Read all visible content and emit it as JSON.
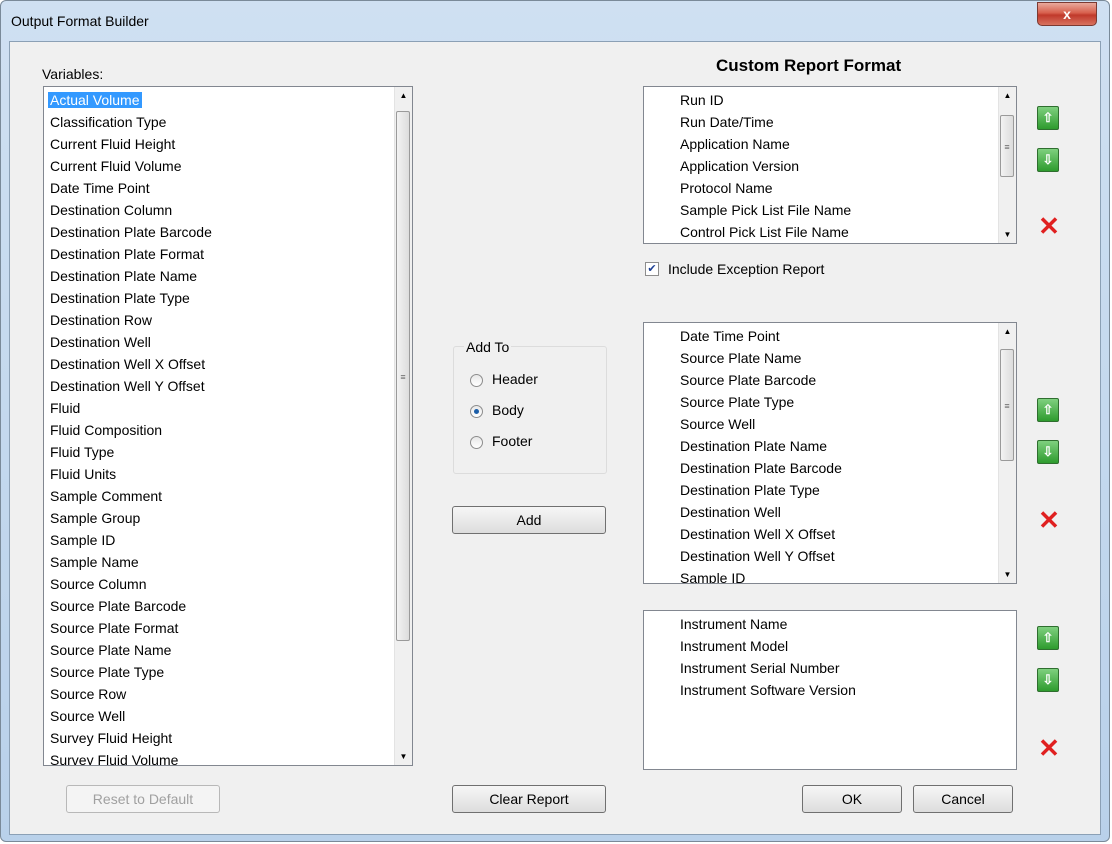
{
  "window": {
    "title": "Output Format Builder",
    "close_glyph": "x"
  },
  "variables": {
    "label": "Variables:",
    "items": [
      {
        "label": "Actual Volume",
        "selected": true
      },
      {
        "label": "Classification Type"
      },
      {
        "label": "Current Fluid Height"
      },
      {
        "label": "Current Fluid Volume"
      },
      {
        "label": "Date Time Point"
      },
      {
        "label": "Destination Column"
      },
      {
        "label": "Destination Plate Barcode"
      },
      {
        "label": "Destination Plate Format"
      },
      {
        "label": "Destination Plate Name"
      },
      {
        "label": "Destination Plate Type"
      },
      {
        "label": "Destination Row"
      },
      {
        "label": "Destination Well"
      },
      {
        "label": "Destination Well X Offset"
      },
      {
        "label": "Destination Well Y Offset"
      },
      {
        "label": "Fluid"
      },
      {
        "label": "Fluid Composition"
      },
      {
        "label": "Fluid Type"
      },
      {
        "label": "Fluid Units"
      },
      {
        "label": "Sample Comment"
      },
      {
        "label": "Sample Group"
      },
      {
        "label": "Sample ID"
      },
      {
        "label": "Sample Name"
      },
      {
        "label": "Source Column"
      },
      {
        "label": "Source Plate Barcode"
      },
      {
        "label": "Source Plate Format"
      },
      {
        "label": "Source Plate Name"
      },
      {
        "label": "Source Plate Type"
      },
      {
        "label": "Source Row"
      },
      {
        "label": "Source Well"
      },
      {
        "label": "Survey Fluid Height"
      },
      {
        "label": "Survey Fluid Volume"
      }
    ]
  },
  "add_to": {
    "label": "Add To",
    "options": [
      {
        "label": "Header",
        "selected": false
      },
      {
        "label": "Body",
        "selected": true
      },
      {
        "label": "Footer",
        "selected": false
      }
    ]
  },
  "buttons": {
    "add": "Add",
    "clear_report": "Clear Report",
    "reset_default": "Reset to Default",
    "ok": "OK",
    "cancel": "Cancel"
  },
  "custom_report": {
    "heading": "Custom Report Format",
    "header_items": [
      "Run ID",
      "Run Date/Time",
      "Application Name",
      "Application Version",
      "Protocol Name",
      "Sample Pick List File Name",
      "Control Pick List File Name"
    ],
    "include_exception": {
      "label": "Include Exception Report",
      "checked": true
    },
    "body_items": [
      "Date Time Point",
      "Source Plate Name",
      "Source Plate Barcode",
      "Source Plate Type",
      "Source Well",
      "Destination Plate Name",
      "Destination Plate Barcode",
      "Destination Plate Type",
      "Destination Well",
      "Destination Well X Offset",
      "Destination Well Y Offset",
      "Sample ID"
    ],
    "footer_items": [
      "Instrument Name",
      "Instrument Model",
      "Instrument Serial Number",
      "Instrument Software Version"
    ]
  },
  "icons": {
    "move_up": "arrow-up-icon",
    "move_down": "arrow-down-icon",
    "delete": "red-x-icon"
  }
}
